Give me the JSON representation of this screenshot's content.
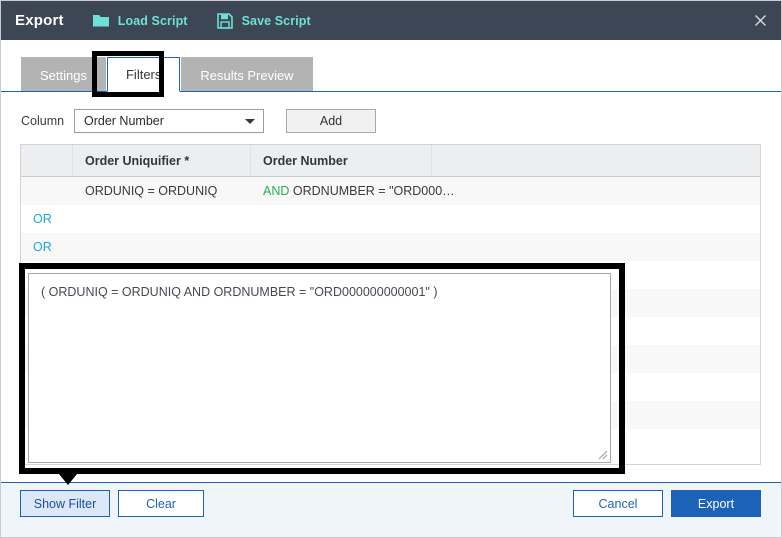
{
  "window": {
    "title": "Export",
    "close_icon": "close-x-icon",
    "actions": [
      {
        "label": "Load Script",
        "icon": "folder-open-icon"
      },
      {
        "label": "Save Script",
        "icon": "floppy-disk-save-icon"
      }
    ]
  },
  "tabs": [
    {
      "label": "Settings",
      "active": false
    },
    {
      "label": "Filters",
      "active": true
    },
    {
      "label": "Results Preview",
      "active": false
    }
  ],
  "column_row": {
    "label": "Column",
    "select_value": "Order Number",
    "select_caret_icon": "chevron-down-icon",
    "add_label": "Add"
  },
  "grid": {
    "headers": [
      "",
      "Order Uniquifier *",
      "Order Number",
      ""
    ],
    "rows": [
      {
        "operator": "",
        "col1": "ORDUNIQ = ORDUNIQ",
        "op2": "AND",
        "col2": "ORDNUMBER = \"ORD000…"
      },
      {
        "operator": "OR",
        "col1": "",
        "op2": "",
        "col2": ""
      },
      {
        "operator": "OR",
        "col1": "",
        "op2": "",
        "col2": ""
      },
      {
        "operator": "",
        "col1": "",
        "op2": "",
        "col2": ""
      },
      {
        "operator": "",
        "col1": "",
        "op2": "",
        "col2": ""
      },
      {
        "operator": "",
        "col1": "",
        "op2": "",
        "col2": ""
      },
      {
        "operator": "",
        "col1": "",
        "op2": "",
        "col2": ""
      },
      {
        "operator": "",
        "col1": "",
        "op2": "",
        "col2": ""
      },
      {
        "operator": "",
        "col1": "",
        "op2": "",
        "col2": ""
      },
      {
        "operator": "",
        "col1": "",
        "op2": "",
        "col2": ""
      }
    ]
  },
  "filter_textarea": {
    "value": "( ORDUNIQ = ORDUNIQ AND ORDNUMBER = \"ORD000000000001\" )",
    "placeholder": ""
  },
  "footer": {
    "show_filter_label": "Show Filter",
    "clear_label": "Clear",
    "cancel_label": "Cancel",
    "export_label": "Export"
  },
  "colors": {
    "titlebar": "#3d4655",
    "accent_teal": "#6fe0d8",
    "accent_blue": "#1c62b9",
    "operator_and": "#25b04b",
    "operator_or": "#19a8d8",
    "annotation": "#000000"
  }
}
